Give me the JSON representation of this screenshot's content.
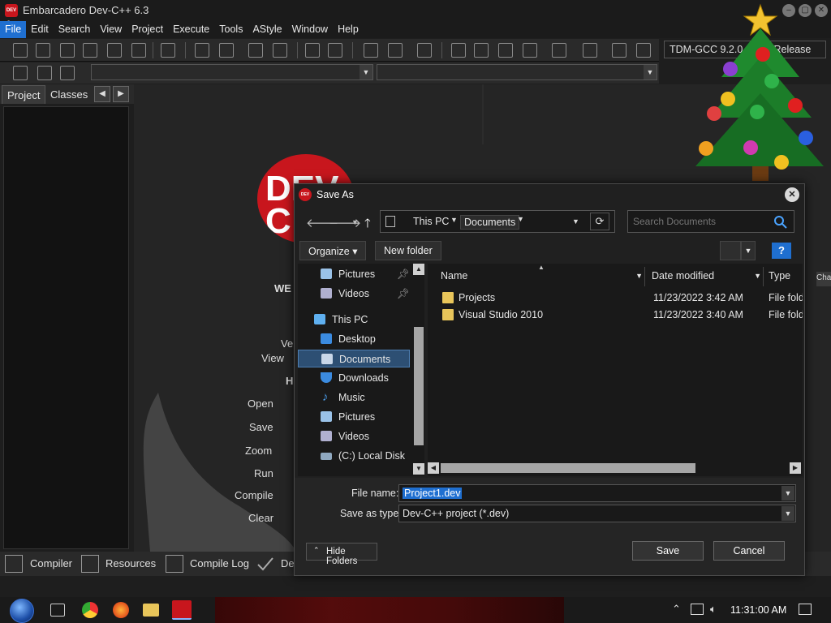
{
  "window": {
    "title": "Embarcadero Dev-C++ 6.3",
    "app_icon_text": "DEV C++"
  },
  "menu": [
    "File",
    "Edit",
    "Search",
    "View",
    "Project",
    "Execute",
    "Tools",
    "AStyle",
    "Window",
    "Help"
  ],
  "compiler": {
    "selected": "TDM-GCC 9.2.0 64-bit Release"
  },
  "left_tabs": [
    "Project",
    "Classes"
  ],
  "welcome": {
    "logo_text_top": "DEV",
    "logo_text_bottom": "C",
    "heading": "WE",
    "version_label": "Ve",
    "view_label": "View",
    "h_label": "H",
    "actions": [
      "Open",
      "Save",
      "Zoom",
      "Run",
      "Compile",
      "Clear"
    ]
  },
  "bottom_tabs": [
    "Compiler",
    "Resources",
    "Compile Log",
    "De"
  ],
  "right_edge_label": "Cha",
  "dialog": {
    "title": "Save As",
    "icon_text": "DEV",
    "breadcrumbs": [
      "This PC",
      "Documents"
    ],
    "search_placeholder": "Search Documents",
    "organize_label": "Organize",
    "new_folder_label": "New folder",
    "help_label": "?",
    "tree": [
      {
        "label": "Pictures",
        "icon": "pictures-icon",
        "pinned": true
      },
      {
        "label": "Videos",
        "icon": "videos-icon",
        "pinned": true
      },
      {
        "label": "This PC",
        "icon": "computer-icon",
        "pinned": false
      },
      {
        "label": "Desktop",
        "icon": "desktop-icon",
        "pinned": false
      },
      {
        "label": "Documents",
        "icon": "documents-icon",
        "pinned": false,
        "selected": true
      },
      {
        "label": "Downloads",
        "icon": "downloads-icon",
        "pinned": false
      },
      {
        "label": "Music",
        "icon": "music-icon",
        "pinned": false
      },
      {
        "label": "Pictures",
        "icon": "pictures-icon",
        "pinned": false
      },
      {
        "label": "Videos",
        "icon": "videos-icon",
        "pinned": false
      },
      {
        "label": "(C:) Local Disk",
        "icon": "disk-icon",
        "pinned": false
      }
    ],
    "columns": {
      "name": "Name",
      "date": "Date modified",
      "type": "Type"
    },
    "files": [
      {
        "name": "Projects",
        "date": "11/23/2022 3:42 AM",
        "type": "File fold"
      },
      {
        "name": "Visual Studio 2010",
        "date": "11/23/2022 3:40 AM",
        "type": "File fold"
      }
    ],
    "filename_label": "File name:",
    "filename_value": "Project1.dev",
    "savetype_label": "Save as type:",
    "savetype_value": "Dev-C++ project (*.dev)",
    "hide_folders_label": "Hide Folders",
    "save_label": "Save",
    "cancel_label": "Cancel"
  },
  "taskbar": {
    "clock": "11:31:00 AM"
  },
  "colors": {
    "accent": "#1f6fd0",
    "brand_red": "#c8161d",
    "folder": "#e8c55a"
  }
}
